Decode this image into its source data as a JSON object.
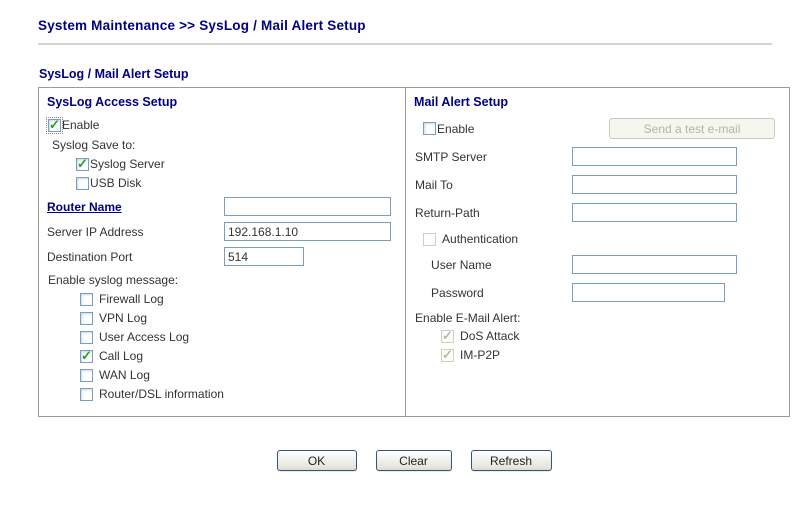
{
  "page": {
    "breadcrumb": "System Maintenance >> SysLog / Mail Alert Setup",
    "section_title": "SysLog / Mail Alert Setup"
  },
  "syslog": {
    "title": "SysLog Access Setup",
    "enable_label": "Enable",
    "enable_checked": true,
    "save_to_label": "Syslog Save to:",
    "save_targets": [
      {
        "label": "Syslog Server",
        "checked": true
      },
      {
        "label": "USB Disk",
        "checked": false
      }
    ],
    "router_name_label": "Router Name",
    "router_name_value": "",
    "server_ip_label": "Server IP Address",
    "server_ip_value": "192.168.1.10",
    "dest_port_label": "Destination Port",
    "dest_port_value": "514",
    "message_label": "Enable syslog message:",
    "messages": [
      {
        "label": "Firewall Log",
        "checked": false
      },
      {
        "label": "VPN Log",
        "checked": false
      },
      {
        "label": "User Access Log",
        "checked": false
      },
      {
        "label": "Call Log",
        "checked": true
      },
      {
        "label": "WAN Log",
        "checked": false
      },
      {
        "label": "Router/DSL information",
        "checked": false
      }
    ]
  },
  "mail": {
    "title": "Mail Alert Setup",
    "enable_label": "Enable",
    "enable_checked": false,
    "test_button_label": "Send a test e-mail",
    "test_button_enabled": false,
    "smtp_label": "SMTP Server",
    "smtp_value": "",
    "mailto_label": "Mail To",
    "mailto_value": "",
    "returnpath_label": "Return-Path",
    "returnpath_value": "",
    "auth_label": "Authentication",
    "auth_checked": false,
    "username_label": "User Name",
    "username_value": "",
    "password_label": "Password",
    "password_value": "",
    "alert_label": "Enable E-Mail Alert:",
    "alerts": [
      {
        "label": "DoS Attack",
        "checked": true
      },
      {
        "label": "IM-P2P",
        "checked": true
      }
    ]
  },
  "actions": {
    "ok": "OK",
    "clear": "Clear",
    "refresh": "Refresh"
  },
  "colors": {
    "heading": "#000080",
    "input_border": "#7b9ebd",
    "check_green": "#21a121",
    "panel_border": "#9e9e8c",
    "disabled_text": "#b3b3a6"
  }
}
